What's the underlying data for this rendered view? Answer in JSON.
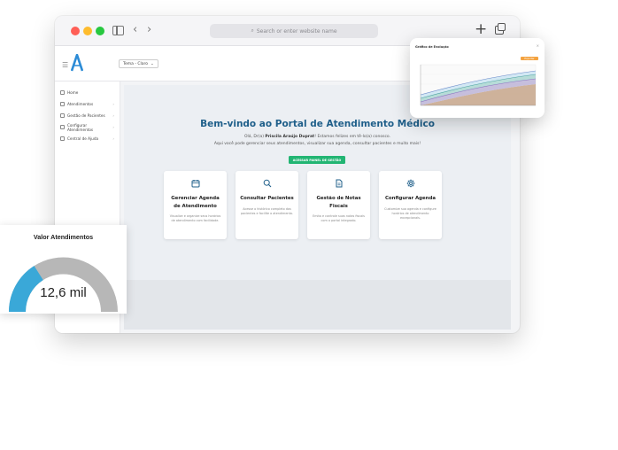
{
  "browser": {
    "address_placeholder": "Search or enter website name"
  },
  "app": {
    "theme_select": "Tema - Claro",
    "sidebar": {
      "items": [
        {
          "label": "Home",
          "icon": "home-icon"
        },
        {
          "label": "Atendimentos",
          "icon": "calendar-icon"
        },
        {
          "label": "Gestão de Pacientes",
          "icon": "users-icon"
        },
        {
          "label": "Configurar Atendimentos",
          "icon": "gear-icon"
        },
        {
          "label": "Central de Ajuda",
          "icon": "help-icon"
        }
      ]
    },
    "welcome": {
      "title": "Bem-vindo ao Portal de Atendimento Médico",
      "line1_pre": "Olá, Dr(a) ",
      "line1_name": "Priscila Araújo Duprat",
      "line1_post": "! Estamos felizes em tê-lo(a) conosco.",
      "line2": "Aqui você pode gerenciar seus atendimentos, visualizar sua agenda, consultar pacientes e muito mais!",
      "cta": "ACESSAR PAINEL DE GESTÃO"
    },
    "cards": [
      {
        "title": "Gerenciar Agenda de Atendimento",
        "desc": "Visualize e organize seus horários de atendimento com facilidade.",
        "icon": "calendar-icon"
      },
      {
        "title": "Consultar Pacientes",
        "desc": "Acesse o histórico completo dos pacientes e facilite o atendimento.",
        "icon": "search-icon"
      },
      {
        "title": "Gestão de Notas Fiscais",
        "desc": "Emita e controle suas notas fiscais com o portal integrado.",
        "icon": "document-icon"
      },
      {
        "title": "Configurar Agenda",
        "desc": "Customize sua agenda e configure horários de atendimento excepcionais.",
        "icon": "gear-icon"
      }
    ]
  },
  "float_panel": {
    "title": "Gráfico de Evolução",
    "button": "Exportar"
  },
  "gauge": {
    "title": "Valor Atendimentos",
    "value": "12,6 mil",
    "fraction": 0.32,
    "color_fill": "#3aa8d8",
    "color_track": "#b7b7b7"
  },
  "colors": {
    "primary": "#1f5f8a",
    "cta_green": "#22b573",
    "export_orange": "#f4a340"
  }
}
